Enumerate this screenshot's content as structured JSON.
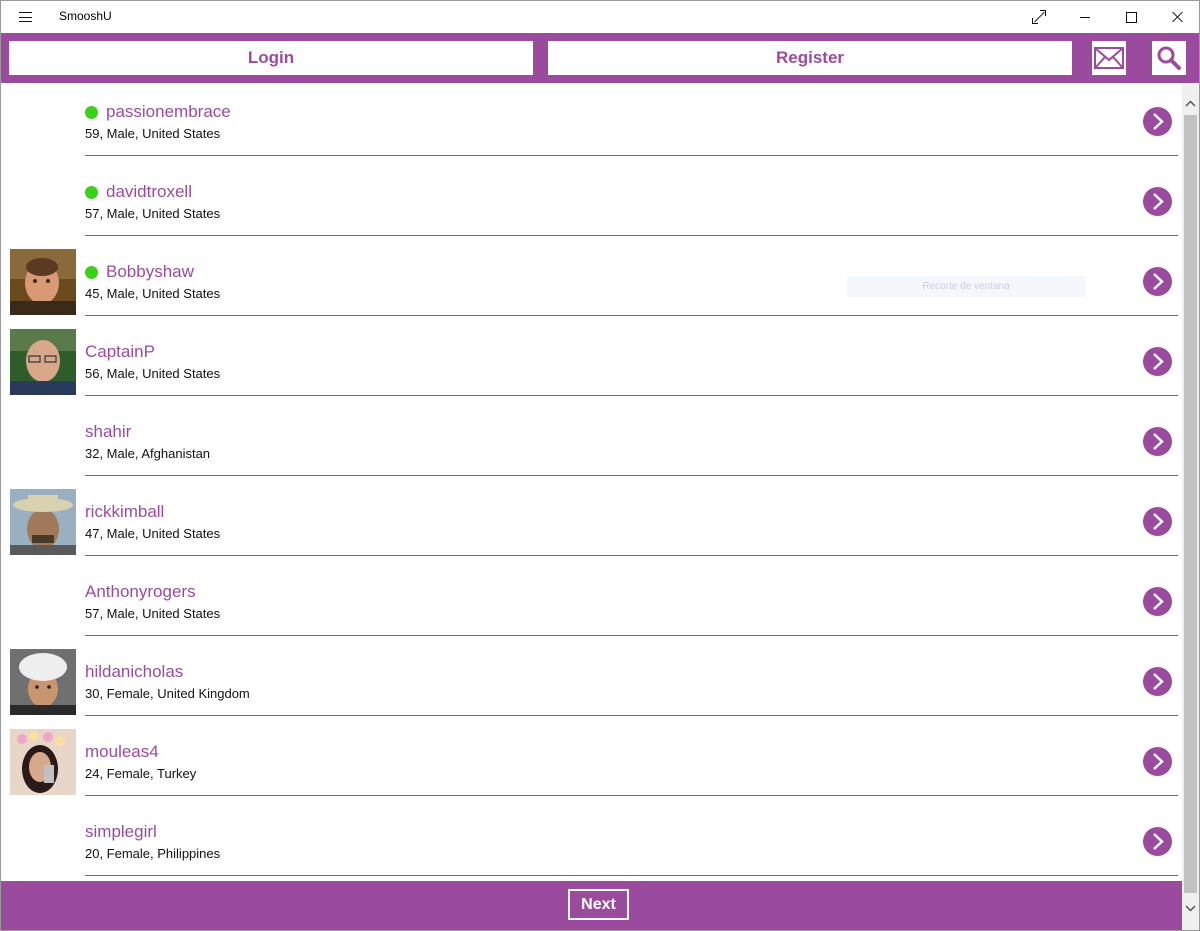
{
  "window": {
    "title": "SmooshU"
  },
  "header": {
    "login_label": "Login",
    "register_label": "Register",
    "mail_icon": "mail-icon",
    "search_icon": "search-icon"
  },
  "colors": {
    "accent": "#9b4b9e",
    "online": "#3bd11a"
  },
  "users": [
    {
      "name": "passionembrace",
      "details": "59, Male, United States",
      "online": true,
      "avatar": "none"
    },
    {
      "name": "davidtroxell",
      "details": "57, Male, United States",
      "online": true,
      "avatar": "none"
    },
    {
      "name": "Bobbyshaw",
      "details": "45, Male, United States",
      "online": true,
      "avatar": "photo"
    },
    {
      "name": "CaptainP",
      "details": "56, Male, United States",
      "online": false,
      "avatar": "photo"
    },
    {
      "name": "shahir",
      "details": "32, Male, Afghanistan",
      "online": false,
      "avatar": "none"
    },
    {
      "name": "rickkimball",
      "details": "47, Male, United States",
      "online": false,
      "avatar": "photo"
    },
    {
      "name": "Anthonyrogers",
      "details": "57, Male, United States",
      "online": false,
      "avatar": "none"
    },
    {
      "name": "hildanicholas",
      "details": "30, Female, United Kingdom",
      "online": false,
      "avatar": "photo"
    },
    {
      "name": "mouleas4",
      "details": "24, Female, Turkey",
      "online": false,
      "avatar": "photo"
    },
    {
      "name": "simplegirl",
      "details": "20, Female, Philippines",
      "online": false,
      "avatar": "none"
    }
  ],
  "overlay": {
    "text": "Recorte de ventana"
  },
  "footer": {
    "next_label": "Next"
  }
}
